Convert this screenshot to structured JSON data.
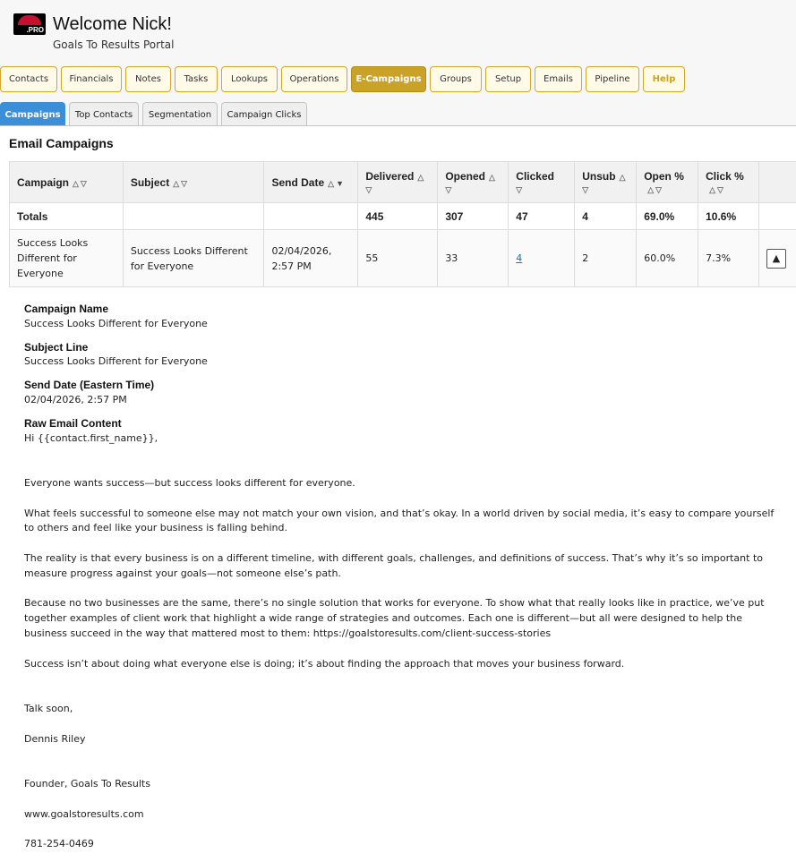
{
  "header": {
    "logo_text": ".PRO",
    "welcome": "Welcome Nick!",
    "portal": "Goals To Results Portal"
  },
  "nav": [
    {
      "label": "Contacts"
    },
    {
      "label": "Financials"
    },
    {
      "label": "Notes"
    },
    {
      "label": "Tasks"
    },
    {
      "label": "Lookups"
    },
    {
      "label": "Operations"
    },
    {
      "label": "E-Campaigns",
      "active": true
    },
    {
      "label": "Groups"
    },
    {
      "label": "Setup"
    },
    {
      "label": "Emails"
    },
    {
      "label": "Pipeline"
    },
    {
      "label": "Help"
    }
  ],
  "subtabs": [
    {
      "label": "Campaigns",
      "active": true
    },
    {
      "label": "Top Contacts"
    },
    {
      "label": "Segmentation"
    },
    {
      "label": "Campaign Clicks"
    }
  ],
  "panel_title": "Email Campaigns",
  "table": {
    "columns": [
      "Campaign",
      "Subject",
      "Send Date",
      "Delivered",
      "Opened",
      "Clicked",
      "Unsub",
      "Open %",
      "Click %"
    ],
    "totals": {
      "label": "Totals",
      "delivered": "445",
      "opened": "307",
      "clicked": "47",
      "unsub": "4",
      "open_pct": "69.0%",
      "click_pct": "10.6%"
    },
    "row": {
      "campaign": "Success Looks Different for Everyone",
      "subject": "Success Looks Different for Everyone",
      "send_date": "02/04/2026, 2:57 PM",
      "delivered": "55",
      "opened": "33",
      "clicked": "4",
      "unsub": "2",
      "open_pct": "60.0%",
      "click_pct": "7.3%",
      "toggle_glyph": "▲"
    }
  },
  "detail": {
    "name_label": "Campaign Name",
    "name_value": "Success Looks Different for Everyone",
    "subject_label": "Subject Line",
    "subject_value": "Success Looks Different for Everyone",
    "date_label": "Send Date (Eastern Time)",
    "date_value": "02/04/2026, 2:57 PM",
    "content_label": "Raw Email Content",
    "content": "Hi {{contact.first_name}},\n\n\nEveryone wants success—but success looks different for everyone.\n\nWhat feels successful to someone else may not match your own vision, and that’s okay. In a world driven by social media, it’s easy to compare yourself to others and feel like your business is falling behind.\n\nThe reality is that every business is on a different timeline, with different goals, challenges, and definitions of success. That’s why it’s so important to measure progress against your goals—not someone else’s path.\n\nBecause no two businesses are the same, there’s no single solution that works for everyone. To show what that really looks like in practice, we’ve put together examples of client work that highlight a wide range of strategies and outcomes. Each one is different—but all were designed to help the business succeed in the way that mattered most to them: https://goalstoresults.com/client-success-stories\n\nSuccess isn’t about doing what everyone else is doing; it’s about finding the approach that moves your business forward.\n\n\nTalk soon,\n\nDennis Riley\n\n\nFounder, Goals To Results\n\nwww.goalstoresults.com\n\n781-254-0469"
  },
  "colors": {
    "accent_gold": "#c9a227",
    "tab_blue": "#3b8fd9",
    "link": "#1a73a8"
  }
}
